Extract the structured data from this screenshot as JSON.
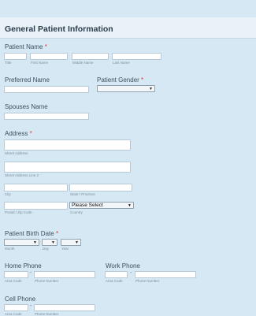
{
  "form": {
    "title": "General Patient Information",
    "required_mark": "*",
    "patient_name": {
      "label": "Patient Name",
      "sublabels": [
        "Title",
        "First Name",
        "Middle Name",
        "Last Name"
      ]
    },
    "preferred_name": {
      "label": "Preferred Name"
    },
    "patient_gender": {
      "label": "Patient Gender",
      "selected": ""
    },
    "spouses_name": {
      "label": "Spouses Name"
    },
    "address": {
      "label": "Address",
      "street": "Street Address",
      "street2": "Street Address Line 2",
      "city": "City",
      "state": "State / Province",
      "postal": "Postal / Zip Code",
      "country": "Country",
      "country_selected": "Please Select"
    },
    "birth_date": {
      "label": "Patient Birth Date",
      "sublabels": [
        "Month",
        "Day",
        "Year"
      ]
    },
    "home_phone": {
      "label": "Home Phone",
      "area": "Area Code",
      "number": "Phone Number",
      "dash": "-"
    },
    "work_phone": {
      "label": "Work Phone",
      "area": "Area Code",
      "number": "Phone Number",
      "dash": "-"
    },
    "cell_phone": {
      "label": "Cell Phone",
      "area": "Area Code",
      "number": "Phone Number",
      "dash": "-"
    }
  },
  "colors": {
    "background": "#d6e8f3",
    "header": "#e9f2f8",
    "required": "#d33a3a"
  },
  "icons": {
    "dropdown": "chevron-down-icon"
  }
}
